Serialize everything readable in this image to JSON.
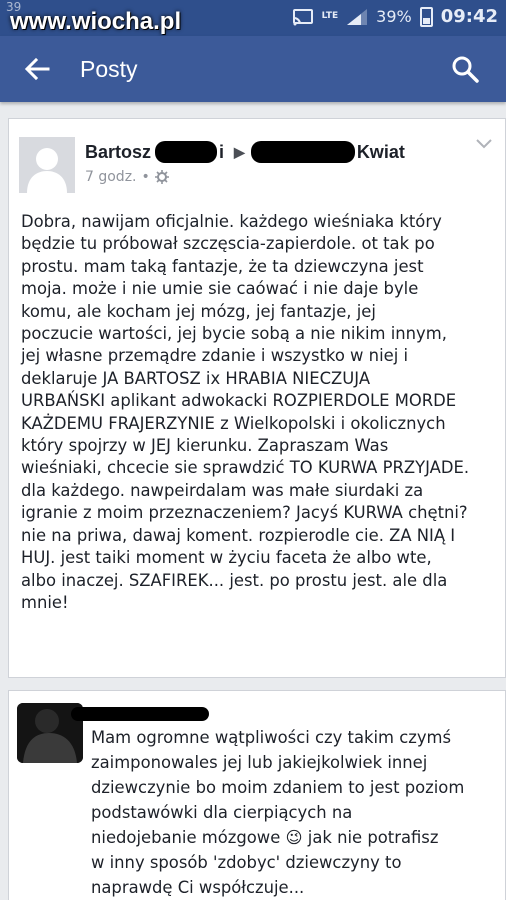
{
  "statusbar": {
    "watermark": "www.wiocha.pl",
    "watermark_ghost": "39",
    "network": "LTE",
    "battery": "39%",
    "time": "09:42"
  },
  "appbar": {
    "title": "Posty",
    "back_icon": "arrow-back-icon",
    "search_icon": "search-icon"
  },
  "post": {
    "author_first": "Bartosz",
    "author_mid": "i",
    "target_last": "Kwiat",
    "time": "7 godz.",
    "text": "Dobra, nawijam oficjalnie. każdego wieśniaka który\nbędzie tu próbował szczęscia-zapierdole. ot tak po\nprostu. mam taką fantazje, że ta dziewczyna jest\nmoja. może i nie umie sie caówać i nie daje byle\nkomu, ale kocham jej mózg, jej fantazje, jej\npoczucie wartości, jej bycie sobą a nie nikim innym,\njej własne przemądre zdanie i wszystko w niej i\ndeklaruje JA BARTOSZ ix HRABIA NIECZUJA\nURBAŃSKI aplikant adwokacki ROZPIERDOLE MORDE\nKAŻDEMU FRAJERZYNIE  z Wielkopolski i okolicznych\nktóry spojrzy w JEJ kierunku. Zapraszam Was\nwieśniaki, chcecie sie sprawdzić TO KURWA PRZYJADE.\ndla każdego. nawpeirdalam was małe siurdaki za\nigranie z moim przeznaczeniem? Jacyś KURWA chętni?\nnie na priwa, dawaj koment. rozpierodle cie.  ZA NIĄ I\nHUJ.  jest taiki moment w życiu faceta że albo wte,\nalbo inaczej. SZAFIREK... jest. po prostu jest. ale dla\nmnie!"
  },
  "comment": {
    "text": "Mam ogromne wątpliwości czy takim czymś\nzaimponowales jej lub jakiejkolwiek innej\ndziewczynie bo moim zdaniem to jest poziom\npodstawówki dla cierpiących na\nniedojebanie mózgowe 😉 jak nie potrafisz\nw inny sposób 'zdobyc' dziewczyny to\nnaprawdę Ci współczuje..."
  },
  "colors": {
    "statusbar": "#2f4f8c",
    "appbar": "#3c5a99",
    "background": "#e9ebee",
    "card": "#ffffff",
    "text": "#1d2129",
    "meta": "#90949c"
  }
}
